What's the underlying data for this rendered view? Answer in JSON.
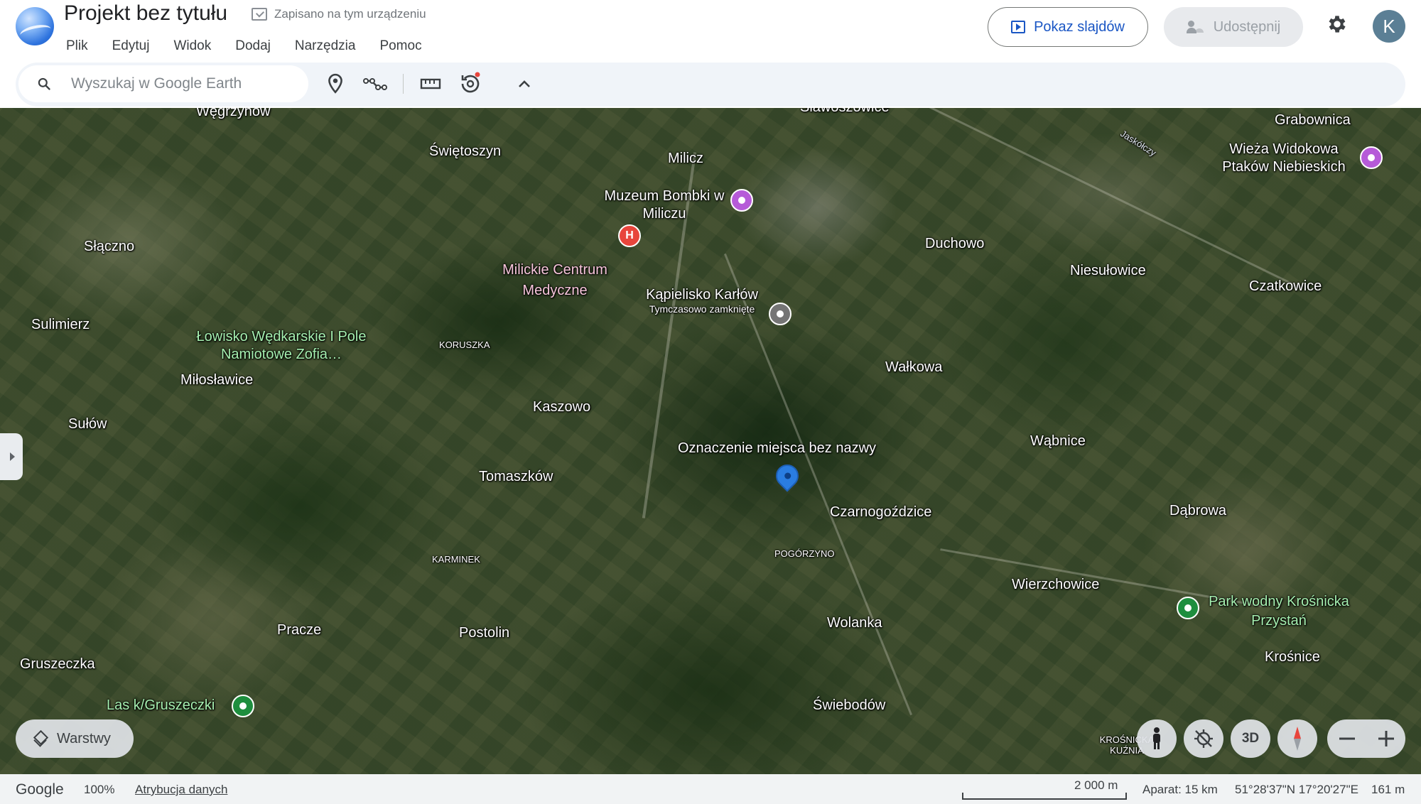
{
  "header": {
    "title": "Projekt bez tytułu",
    "saved_status": "Zapisano na tym urządzeniu",
    "menu": [
      "Plik",
      "Edytuj",
      "Widok",
      "Dodaj",
      "Narzędzia",
      "Pomoc"
    ],
    "slideshow_label": "Pokaz slajdów",
    "share_label": "Udostępnij",
    "avatar_letter": "K"
  },
  "toolbar": {
    "search_placeholder": "Wyszukaj w Google Earth",
    "tools": [
      "add-placemark-icon",
      "draw-line-icon",
      "measure-icon",
      "rotate-history-icon",
      "collapse-chevron-icon"
    ]
  },
  "map": {
    "places": {
      "wegrzynow": "Węgrzynów",
      "slawoszowice": "Sławoszowice",
      "grabownica": "Grabownica",
      "jaskolczy": "Jaskółczy",
      "wieza": "Wieża Widokowa Ptaków Niebieskich",
      "swietoszyn": "Świętoszyn",
      "milicz": "Milicz",
      "muzeum": "Muzeum Bombki w Miliczu",
      "slaczno": "Słączno",
      "milickie": "Milickie Centrum Medyczne",
      "duchowo": "Duchowo",
      "niesulowice": "Niesułowice",
      "czatkowice": "Czatkowice",
      "kapielisko": "Kąpielisko Karłów",
      "kapielisko_status": "Tymczasowo zamknięte",
      "sulimierz": "Sulimierz",
      "lowisko": "Łowisko Wędkarskie I Pole Namiotowe Zofia…",
      "koruszka": "KORUSZKA",
      "milosławice": "Miłosławice",
      "walkowa": "Wałkowa",
      "sulow": "Sułów",
      "kaszowo": "Kaszowo",
      "wabnice": "Wąbnice",
      "oznaczenie": "Oznaczenie miejsca bez nazwy",
      "tomaszkow": "Tomaszków",
      "czarnogozdzice": "Czarnogoździce",
      "dabrowa": "Dąbrowa",
      "karminek": "KARMINEK",
      "pogorzyno": "POGÓRZYNO",
      "wierzchowice": "Wierzchowice",
      "park_wodny": "Park wodny Krośnicka Przystań",
      "pracze": "Pracze",
      "postolin": "Postolin",
      "wolanka": "Wolanka",
      "krosnice": "Krośnice",
      "gruszeczka": "Gruszeczka",
      "las": "Las k/Gruszeczki",
      "swiebodow": "Świebodów",
      "krosnicka_kuznia": "KROŚNICKA KUŹNIA"
    },
    "layers_label": "Warstwy",
    "view_mode_label": "3D"
  },
  "footer": {
    "brand": "Google",
    "zoom": "100%",
    "attribution": "Atrybucja danych",
    "scale": "2 000 m",
    "camera": "Aparat: 15 km",
    "coordinates": "51°28'37\"N 17°20'27\"E",
    "elevation": "161 m"
  },
  "colors": {
    "accent": "#1a56c4",
    "hospital": "#e8453c",
    "museum": "#b65ad8",
    "park": "#1e8e3e",
    "placemark": "#2a7de1"
  }
}
